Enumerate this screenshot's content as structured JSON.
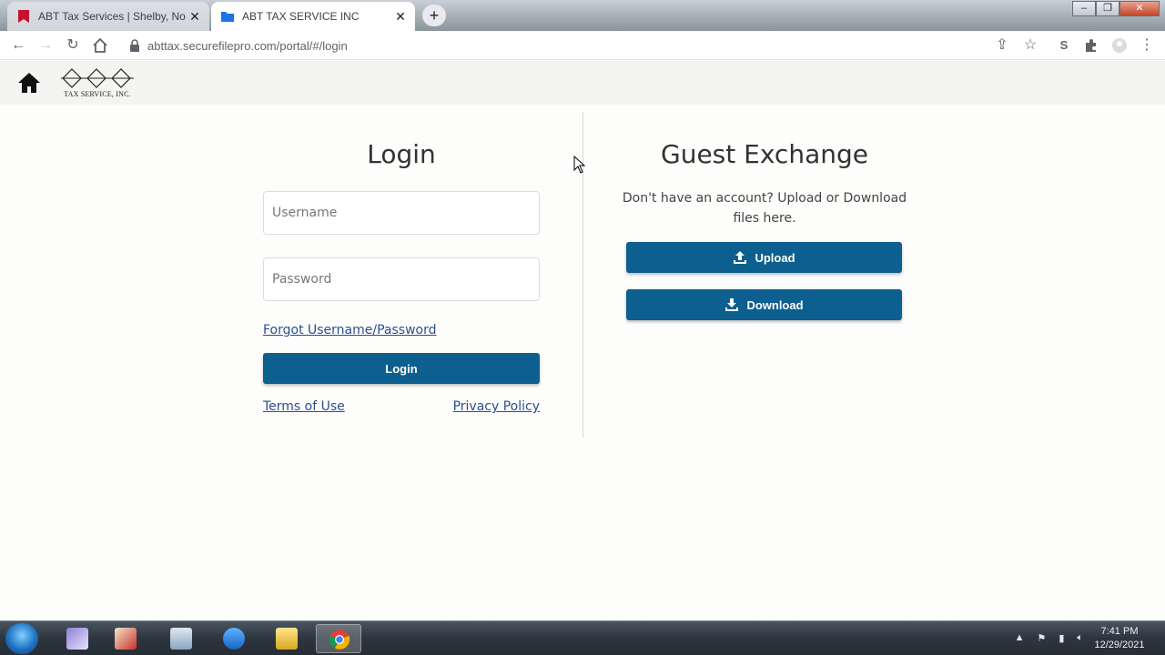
{
  "browser": {
    "tabs": [
      {
        "title": "ABT Tax Services | Shelby, North",
        "active": false,
        "favicon_color": "#c8102e"
      },
      {
        "title": "ABT TAX SERVICE INC",
        "active": true,
        "favicon_color": "#1a73e8"
      }
    ],
    "url": "abttax.securefilepro.com/portal/#/login"
  },
  "site": {
    "logo_letters": "ABT",
    "logo_subtitle": "TAX SERVICE, INC."
  },
  "login": {
    "title": "Login",
    "username_placeholder": "Username",
    "password_placeholder": "Password",
    "forgot_link": "Forgot Username/Password",
    "submit_label": "Login",
    "terms_link": "Terms of Use",
    "privacy_link": "Privacy Policy"
  },
  "guest": {
    "title": "Guest Exchange",
    "description": "Don't have an account? Upload or Download files here.",
    "upload_label": "Upload",
    "download_label": "Download"
  },
  "taskbar": {
    "time": "7:41 PM",
    "date": "12/29/2021"
  },
  "colors": {
    "primary_button": "#0d5f8f",
    "link": "#2a4f8f"
  }
}
